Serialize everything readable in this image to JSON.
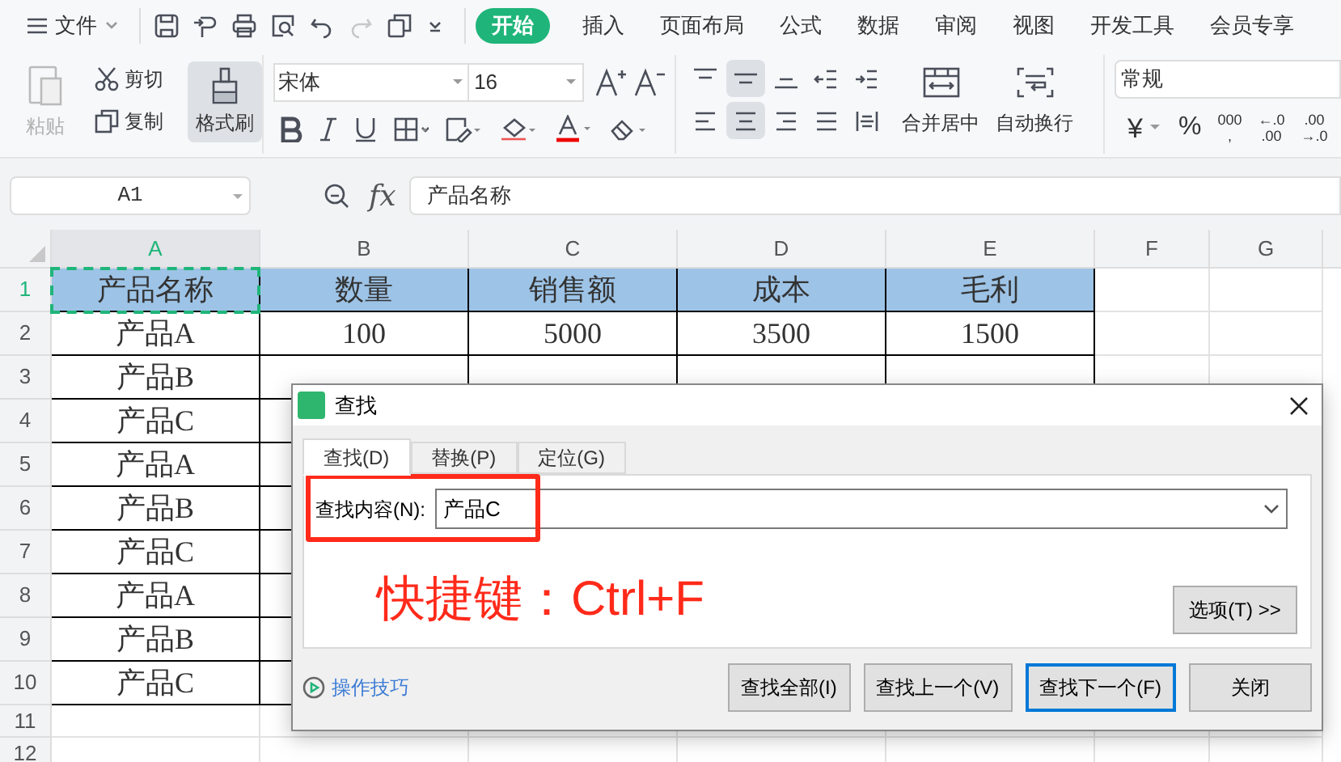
{
  "menu": {
    "file": "文件",
    "tabs": [
      {
        "label": "开始",
        "selected": true
      },
      {
        "label": "插入",
        "selected": false
      },
      {
        "label": "页面布局",
        "selected": false
      },
      {
        "label": "公式",
        "selected": false
      },
      {
        "label": "数据",
        "selected": false
      },
      {
        "label": "审阅",
        "selected": false
      },
      {
        "label": "视图",
        "selected": false
      },
      {
        "label": "开发工具",
        "selected": false
      },
      {
        "label": "会员专享",
        "selected": false
      }
    ]
  },
  "ribbon": {
    "paste": {
      "label": "粘贴",
      "disabled": true
    },
    "cut": "剪切",
    "copy": "复制",
    "format_painter": {
      "label": "格式刷",
      "selected": true
    },
    "font_name": "宋体",
    "font_size": "16",
    "align_buttons": [
      {
        "kind": "top",
        "selected": false
      },
      {
        "kind": "middle",
        "selected": true
      },
      {
        "kind": "bottom",
        "selected": false
      },
      {
        "kind": "outdent",
        "selected": false
      },
      {
        "kind": "indent",
        "selected": false
      },
      {
        "kind": "left",
        "selected": false
      },
      {
        "kind": "center",
        "selected": true
      },
      {
        "kind": "right",
        "selected": false
      },
      {
        "kind": "justify",
        "selected": false
      },
      {
        "kind": "distributed",
        "selected": false
      }
    ],
    "merge": "合并居中",
    "wrap": "自动换行",
    "number_format": "常规",
    "number_buttons": [
      {
        "kind": "currency",
        "label": "¥"
      },
      {
        "kind": "percent",
        "label": "%"
      },
      {
        "kind": "thousands",
        "label": "000",
        "sub": ","
      },
      {
        "kind": "decimal",
        "label": "←.0",
        "sub": ".00"
      },
      {
        "kind": "decimal",
        "label": ".00",
        "sub": "→.0"
      }
    ]
  },
  "name_box": "A1",
  "function_label": "fx",
  "formula": "产品名称",
  "columns": [
    {
      "label": "A",
      "selected": true
    },
    {
      "label": "B",
      "selected": false
    },
    {
      "label": "C",
      "selected": false
    },
    {
      "label": "D",
      "selected": false
    },
    {
      "label": "E",
      "selected": false
    },
    {
      "label": "F",
      "selected": false
    },
    {
      "label": "G",
      "selected": false
    }
  ],
  "rows": [
    {
      "number": "1",
      "kind": "header",
      "selected": true,
      "cells": [
        "产品名称",
        "数量",
        "销售额",
        "成本",
        "毛利"
      ]
    },
    {
      "number": "2",
      "kind": "data",
      "selected": false,
      "cells": [
        "产品A",
        "100",
        "5000",
        "3500",
        "1500"
      ]
    },
    {
      "number": "3",
      "kind": "data",
      "selected": false,
      "cells": [
        "产品B"
      ]
    },
    {
      "number": "4",
      "kind": "data",
      "selected": false,
      "cells": [
        "产品C"
      ]
    },
    {
      "number": "5",
      "kind": "data",
      "selected": false,
      "cells": [
        "产品A"
      ]
    },
    {
      "number": "6",
      "kind": "data",
      "selected": false,
      "cells": [
        "产品B"
      ]
    },
    {
      "number": "7",
      "kind": "data",
      "selected": false,
      "cells": [
        "产品C"
      ]
    },
    {
      "number": "8",
      "kind": "data",
      "selected": false,
      "cells": [
        "产品A"
      ]
    },
    {
      "number": "9",
      "kind": "data",
      "selected": false,
      "cells": [
        "产品B"
      ]
    },
    {
      "number": "10",
      "kind": "data",
      "selected": false,
      "cells": [
        "产品C"
      ]
    },
    {
      "number": "11",
      "kind": "empty",
      "selected": false,
      "cells": []
    },
    {
      "number": "12",
      "kind": "empty",
      "selected": false,
      "cells": []
    }
  ],
  "find_dialog": {
    "title": "查找",
    "tabs": [
      {
        "label": "查找(D)",
        "selected": true
      },
      {
        "label": "替换(P)",
        "selected": false
      },
      {
        "label": "定位(G)",
        "selected": false
      }
    ],
    "field_label": "查找内容(N):",
    "field_value": "产品C",
    "annotation": "快捷键：Ctrl+F",
    "options_button": "选项(T) >>",
    "tips_link": "操作技巧",
    "buttons": [
      {
        "label": "查找全部(I)",
        "focused": false
      },
      {
        "label": "查找上一个(V)",
        "focused": false
      },
      {
        "label": "查找下一个(F)",
        "focused": true
      },
      {
        "label": "关闭",
        "focused": false
      }
    ]
  }
}
